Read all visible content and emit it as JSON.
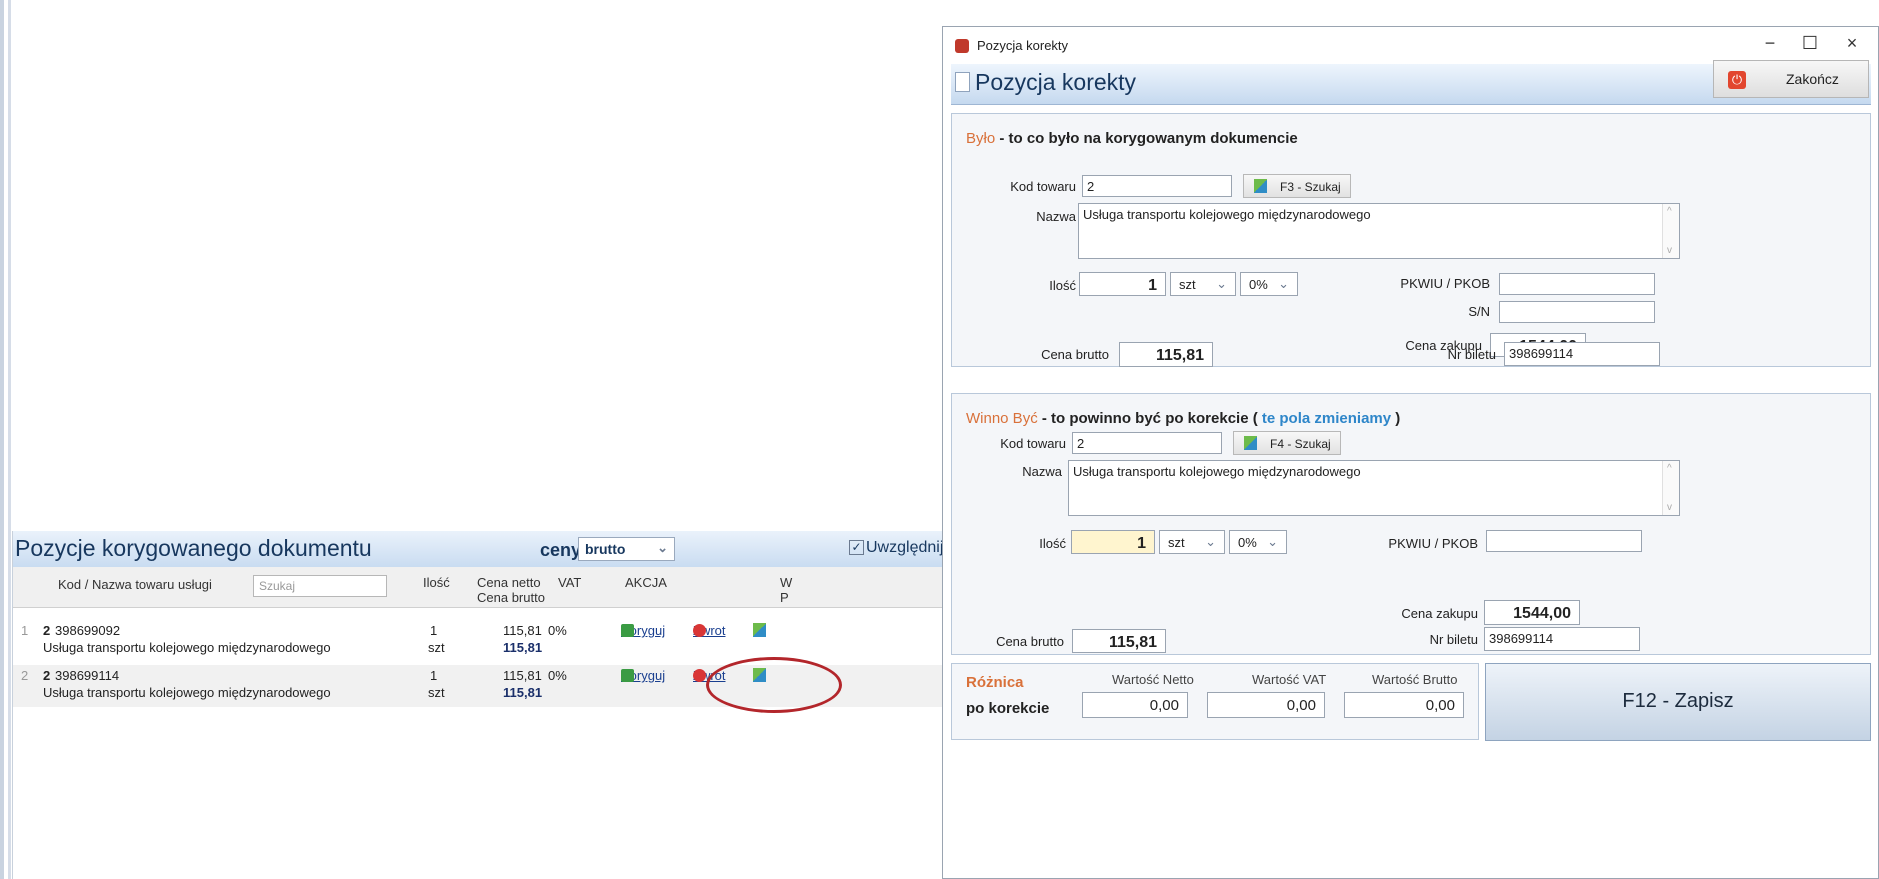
{
  "background": {
    "panel_title": "Pozycje korygowanego dokumentu",
    "ceny_label": "ceny",
    "ceny_value": "brutto",
    "uwzglednij": "Uwzględnij",
    "columns": {
      "kod_nazwa": "Kod / Nazwa towaru usługi",
      "search_placeholder": "Szukaj",
      "ilosc": "Ilość",
      "cena_netto": "Cena netto",
      "cena_brutto": "Cena brutto",
      "vat": "VAT",
      "akcja": "AKCJA",
      "extra1": "W",
      "extra2": "P"
    },
    "rows": [
      {
        "lp": "1",
        "kod": "2",
        "nr": "398699092",
        "nazwa": "Usługa transportu kolejowego międzynarodowego",
        "ilosc": "1",
        "jm": "szt",
        "netto": "115,81",
        "brutto": "115,81",
        "vat": "0%",
        "koryguj": "Koryguj",
        "zwrot": "Zwrot"
      },
      {
        "lp": "2",
        "kod": "2",
        "nr": "398699114",
        "nazwa": "Usługa transportu kolejowego międzynarodowego",
        "ilosc": "1",
        "jm": "szt",
        "netto": "115,81",
        "brutto": "115,81",
        "vat": "0%",
        "koryguj": "Koryguj",
        "zwrot": "Zwrot"
      }
    ]
  },
  "dialog": {
    "window_title": "Pozycja korekty",
    "header_title": "Pozycja korekty",
    "zakoncz": "Zakończ",
    "win_minimize": "−",
    "win_maximize": "☐",
    "win_close": "×",
    "byl": {
      "title_orange": "Było",
      "title_rest": " - to co było na korygowanym dokumencie",
      "kod_label": "Kod towaru",
      "kod_value": "2",
      "search_btn": "F3 - Szukaj",
      "nazwa_label": "Nazwa",
      "nazwa_value": "Usługa transportu kolejowego międzynarodowego",
      "ilosc_label": "Ilość",
      "ilosc_value": "1",
      "jm_value": "szt",
      "vat_value": "0%",
      "pkwiu_label": "PKWIU / PKOB",
      "pkwiu_value": "",
      "sn_label": "S/N",
      "sn_value": "",
      "cena_zakupu_label": "Cena zakupu",
      "cena_zakupu_value": "1544,00",
      "cena_brutto_label": "Cena brutto",
      "cena_brutto_value": "115,81",
      "nr_biletu_label": "Nr biletu",
      "nr_biletu_value": "398699114"
    },
    "winno": {
      "title_orange": "Winno Być",
      "title_mid": " - to powinno być po korekcie ( ",
      "title_blue": "te pola zmieniamy",
      "title_end": " )",
      "kod_label": "Kod towaru",
      "kod_value": "2",
      "search_btn": "F4 - Szukaj",
      "nazwa_label": "Nazwa",
      "nazwa_value": "Usługa transportu kolejowego międzynarodowego",
      "ilosc_label": "Ilość",
      "ilosc_value": "1",
      "jm_value": "szt",
      "vat_value": "0%",
      "pkwiu_label": "PKWIU / PKOB",
      "pkwiu_value": "",
      "cena_zakupu_label": "Cena zakupu",
      "cena_zakupu_value": "1544,00",
      "cena_brutto_label": "Cena brutto",
      "cena_brutto_value": "115,81",
      "nr_biletu_label": "Nr biletu",
      "nr_biletu_value": "398699114"
    },
    "roznica": {
      "title": "Różnica",
      "sub": "po korekcie",
      "netto_label": "Wartość Netto",
      "netto_value": "0,00",
      "vat_label": "Wartość VAT",
      "vat_value": "0,00",
      "brutto_label": "Wartość Brutto",
      "brutto_value": "0,00"
    },
    "save_btn": "F12 - Zapisz"
  }
}
